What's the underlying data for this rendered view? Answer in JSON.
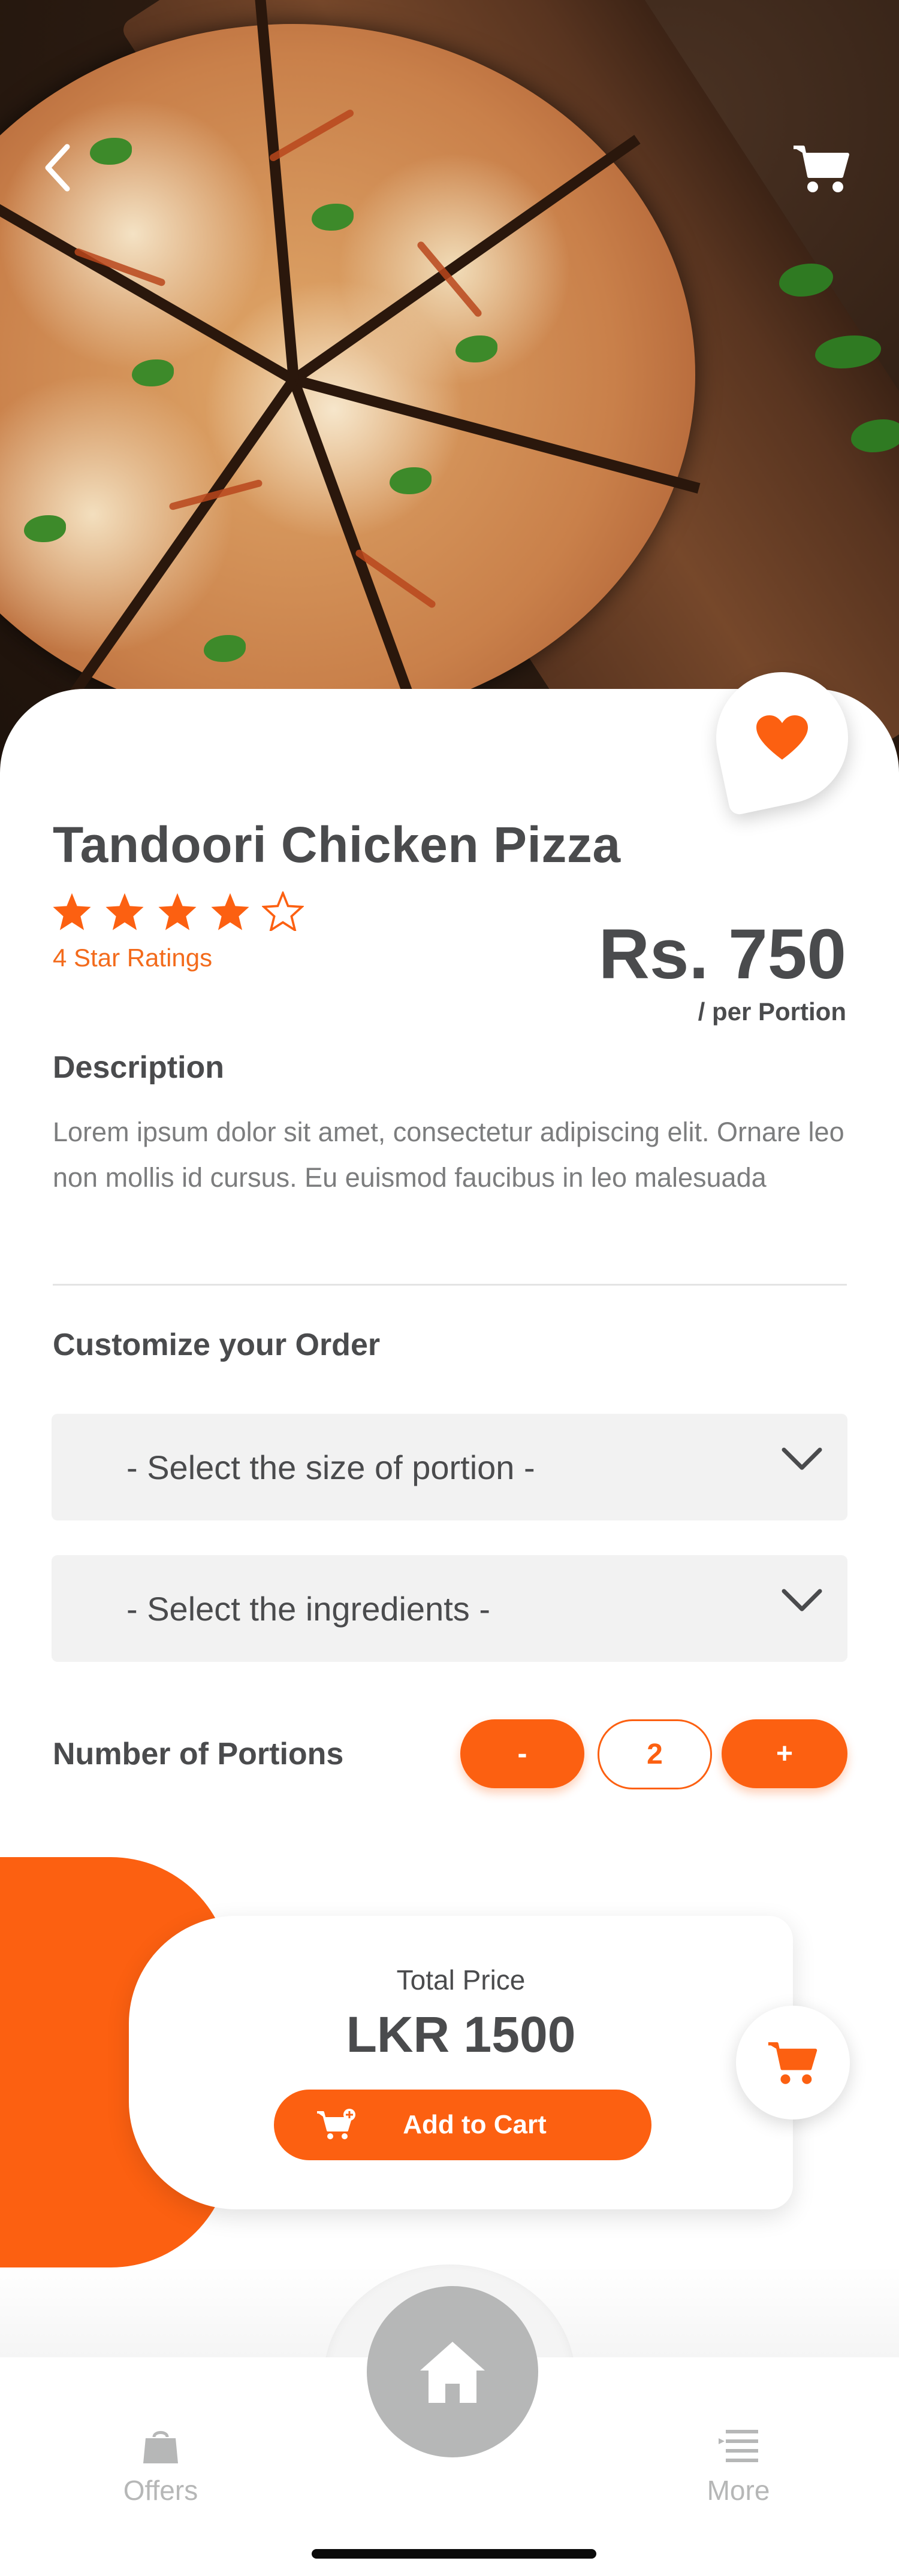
{
  "hero": {
    "back_icon": "chevron-left-icon",
    "cart_icon": "shopping-cart-icon",
    "favorite_icon": "heart-icon"
  },
  "product": {
    "name": "Tandoori Chicken Pizza",
    "rating": 4,
    "rating_max": 5,
    "rating_text": "4 Star Ratings",
    "price": "Rs. 750",
    "price_unit": "/ per Portion"
  },
  "description": {
    "heading": "Description",
    "text": "Lorem ipsum dolor sit amet, consectetur adipiscing elit. Ornare leo non mollis id cursus. Eu euismod faucibus in leo malesuada"
  },
  "customize": {
    "heading": "Customize your Order",
    "size_select": "- Select the size of portion -",
    "ingredients_select": "- Select the ingredients -"
  },
  "portions": {
    "label": "Number of Portions",
    "minus": "-",
    "quantity": "2",
    "plus": "+"
  },
  "total": {
    "label": "Total Price",
    "value": "LKR 1500",
    "add_to_cart": "Add to Cart"
  },
  "tabbar": {
    "offers": "Offers",
    "more": "More",
    "home_icon": "home-icon"
  },
  "colors": {
    "accent": "#fc6011",
    "text_primary": "#4a4b4d",
    "text_secondary": "#7c7d7e",
    "inactive": "#b6b7b7"
  }
}
